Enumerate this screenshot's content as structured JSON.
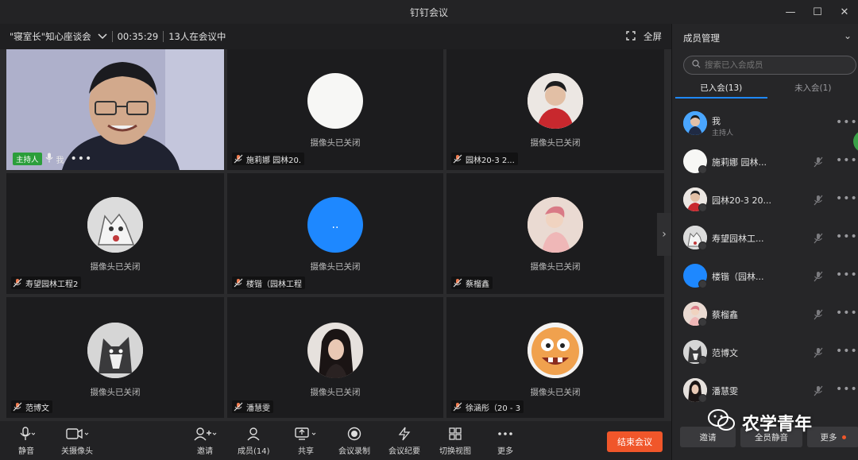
{
  "window": {
    "title": "钉钉会议"
  },
  "meeting": {
    "name": "\"寝室长\"知心座谈会",
    "duration": "00:35:29",
    "count_text": "13人在会议中",
    "fullscreen_label": "全屏"
  },
  "tiles": [
    {
      "name": "我",
      "host_tag": "主持人",
      "self": true
    },
    {
      "name": "施莉娜 园林20.",
      "cam_status": "摄像头已关闭"
    },
    {
      "name": "园林20-3 2...",
      "cam_status": "摄像头已关闭"
    },
    {
      "name": "寿望园林工程2",
      "cam_status": "摄像头已关闭"
    },
    {
      "name": "楼锴（园林工程",
      "cam_status": "摄像头已关闭",
      "avatar_text": ".."
    },
    {
      "name": "蔡榴鑫",
      "cam_status": "摄像头已关闭"
    },
    {
      "name": "范博文",
      "cam_status": "摄像头已关闭"
    },
    {
      "name": "潘慧雯",
      "cam_status": "摄像头已关闭"
    },
    {
      "name": "徐涵彤（20 - 3",
      "cam_status": "摄像头已关闭"
    }
  ],
  "toolbar": {
    "mute": "静音",
    "camera": "关摄像头",
    "invite": "邀请",
    "members": "成员(14)",
    "share": "共享",
    "record": "会议录制",
    "minutes": "会议纪要",
    "switch_view": "切换视图",
    "more": "更多",
    "end": "结束会议"
  },
  "panel": {
    "title": "成员管理",
    "search_placeholder": "搜索已入会成员",
    "tab_joined": "已入会(13)",
    "tab_not_joined": "未入会(1)",
    "members": [
      {
        "name": "我",
        "sub": "主持人"
      },
      {
        "name": "施莉娜 园林..."
      },
      {
        "name": "园林20-3 20..."
      },
      {
        "name": "寿望园林工..."
      },
      {
        "name": "楼锴（园林..."
      },
      {
        "name": "蔡榴鑫"
      },
      {
        "name": "范博文"
      },
      {
        "name": "潘慧雯"
      }
    ],
    "btn_invite": "邀请",
    "btn_mute_all": "全员静音",
    "btn_more": "更多"
  },
  "watermark": {
    "text": "农学青年"
  },
  "colors": {
    "accent": "#1e88ff",
    "end": "#f0562a",
    "host": "#2b9e3a"
  }
}
